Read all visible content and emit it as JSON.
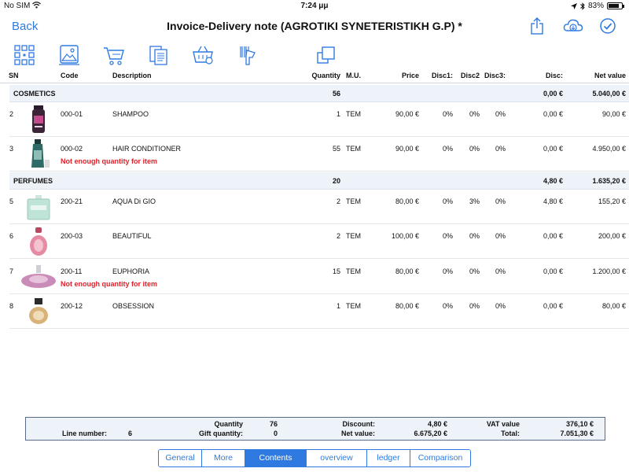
{
  "status": {
    "carrier": "No SIM",
    "time": "7:24 μμ",
    "battery": "83%",
    "battery_level": 0.83
  },
  "nav": {
    "back": "Back",
    "title": "Invoice-Delivery note (AGROTIKI SYNETERISTIKH G.P) *"
  },
  "accent": "#2f7ae0",
  "warning_color": "#e0202a",
  "toolbar_icons": [
    "barcode-grid-icon",
    "gallery-icon",
    "cart-icon",
    "documents-icon",
    "basket-icon",
    "scanner-icon",
    "copy-icon"
  ],
  "columns": {
    "sn": "SN",
    "code": "Code",
    "description": "Description",
    "quantity": "Quantity",
    "mu": "M.U.",
    "price": "Price",
    "disc1": "Disc1:",
    "disc2": "Disc2",
    "disc3": "Disc3:",
    "disc": "Disc:",
    "net": "Net value"
  },
  "groups": [
    {
      "name": "COSMETICS",
      "quantity": "56",
      "disc": "0,00 €",
      "net": "5.040,00 €"
    },
    {
      "name": "PERFUMES",
      "quantity": "20",
      "disc": "4,80 €",
      "net": "1.635,20 €"
    }
  ],
  "rows": [
    {
      "sn": "2",
      "code": "000-01",
      "description": "SHAMPOO",
      "quantity": "1",
      "mu": "TEM",
      "price": "90,00 €",
      "disc1": "0%",
      "disc2": "0%",
      "disc3": "0%",
      "disc": "0,00 €",
      "net": "90,00 €",
      "warning": "",
      "thumb": "shampoo-bottle-image"
    },
    {
      "sn": "3",
      "code": "000-02",
      "description": "HAIR CONDITIONER",
      "quantity": "55",
      "mu": "TEM",
      "price": "90,00 €",
      "disc1": "0%",
      "disc2": "0%",
      "disc3": "0%",
      "disc": "0,00 €",
      "net": "4.950,00 €",
      "warning": "Not enough quantity for item",
      "thumb": "conditioner-bottle-image"
    },
    {
      "sn": "5",
      "code": "200-21",
      "description": "AQUA Di GIO",
      "quantity": "2",
      "mu": "TEM",
      "price": "80,00 €",
      "disc1": "0%",
      "disc2": "3%",
      "disc3": "0%",
      "disc": "4,80 €",
      "net": "155,20 €",
      "warning": "",
      "thumb": "perfume-green-image"
    },
    {
      "sn": "6",
      "code": "200-03",
      "description": "BEAUTIFUL",
      "quantity": "2",
      "mu": "TEM",
      "price": "100,00 €",
      "disc1": "0%",
      "disc2": "0%",
      "disc3": "0%",
      "disc": "0,00 €",
      "net": "200,00 €",
      "warning": "",
      "thumb": "perfume-pink-image"
    },
    {
      "sn": "7",
      "code": "200-11",
      "description": "EUPHORIA",
      "quantity": "15",
      "mu": "TEM",
      "price": "80,00 €",
      "disc1": "0%",
      "disc2": "0%",
      "disc3": "0%",
      "disc": "0,00 €",
      "net": "1.200,00 €",
      "warning": "Not enough quantity for item",
      "thumb": "perfume-purple-image"
    },
    {
      "sn": "8",
      "code": "200-12",
      "description": "OBSESSION",
      "quantity": "1",
      "mu": "TEM",
      "price": "80,00 €",
      "disc1": "0%",
      "disc2": "0%",
      "disc3": "0%",
      "disc": "0,00 €",
      "net": "80,00 €",
      "warning": "",
      "thumb": "perfume-amber-image"
    }
  ],
  "summary": {
    "line_number_label": "Line number:",
    "line_number": "6",
    "quantity_label": "Quantity",
    "quantity": "76",
    "gift_label": "Gift quantity:",
    "gift": "0",
    "discount_label": "Discount:",
    "discount": "4,80 €",
    "net_label": "Net value:",
    "net": "6.675,20 €",
    "vat_label": "VAT value",
    "vat": "376,10 €",
    "total_label": "Total:",
    "total": "7.051,30 €"
  },
  "tabs": [
    {
      "label": "General",
      "active": false
    },
    {
      "label": "More",
      "active": false
    },
    {
      "label": "Contents",
      "active": true
    },
    {
      "label": "overview",
      "active": false
    },
    {
      "label": "ledger",
      "active": false
    },
    {
      "label": "Comparison",
      "active": false
    }
  ]
}
